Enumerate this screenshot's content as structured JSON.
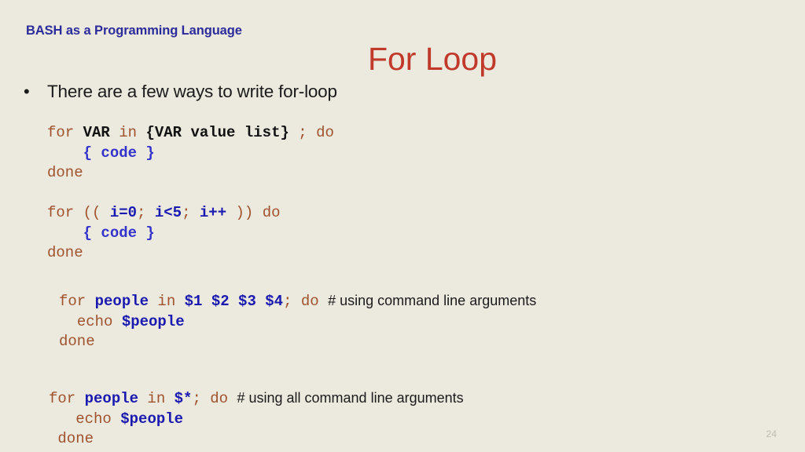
{
  "slide": {
    "kicker": "BASH as a Programming Language",
    "title": "For Loop",
    "bullet_marker": "•",
    "bullet_text": "There are a few ways to write for-loop",
    "page_number": "24",
    "colors": {
      "background": "#ECE9DE",
      "kicker": "#2B2B9B",
      "title": "#C0392B",
      "keyword": "#A0522D",
      "literal": "#111111",
      "code_placeholder": "#3333CC",
      "variable": "#1A1AB0",
      "comment": "#1b1b1b",
      "page_number": "#BDBBAF"
    }
  },
  "code_blocks": [
    {
      "id": "block-1",
      "lines": [
        {
          "indent": "",
          "tokens": [
            {
              "text": "for ",
              "kind": "keyword"
            },
            {
              "text": "VAR",
              "kind": "literal"
            },
            {
              "text": " in ",
              "kind": "keyword"
            },
            {
              "text": "{VAR value list}",
              "kind": "literal"
            },
            {
              "text": " ; ",
              "kind": "keyword"
            },
            {
              "text": "do",
              "kind": "keyword"
            }
          ]
        },
        {
          "indent": "    ",
          "tokens": [
            {
              "text": "{ code }",
              "kind": "code_placeholder"
            }
          ]
        },
        {
          "indent": "",
          "tokens": [
            {
              "text": "done",
              "kind": "keyword"
            }
          ]
        }
      ]
    },
    {
      "id": "block-2",
      "lines": [
        {
          "indent": "",
          "tokens": [
            {
              "text": "for ",
              "kind": "keyword"
            },
            {
              "text": "(( ",
              "kind": "punctuation"
            },
            {
              "text": "i=0",
              "kind": "expression"
            },
            {
              "text": "; ",
              "kind": "punctuation"
            },
            {
              "text": "i<5",
              "kind": "expression"
            },
            {
              "text": "; ",
              "kind": "punctuation"
            },
            {
              "text": "i++",
              "kind": "expression"
            },
            {
              "text": " )) ",
              "kind": "punctuation"
            },
            {
              "text": "do",
              "kind": "keyword"
            }
          ]
        },
        {
          "indent": "    ",
          "tokens": [
            {
              "text": "{ code }",
              "kind": "code_placeholder"
            }
          ]
        },
        {
          "indent": "",
          "tokens": [
            {
              "text": "done",
              "kind": "keyword"
            }
          ]
        }
      ]
    },
    {
      "id": "block-3",
      "lines": [
        {
          "indent": "",
          "tokens": [
            {
              "text": "for ",
              "kind": "keyword"
            },
            {
              "text": "people",
              "kind": "variable"
            },
            {
              "text": " in ",
              "kind": "keyword"
            },
            {
              "text": "$1 $2 $3 $4",
              "kind": "variable"
            },
            {
              "text": "; ",
              "kind": "keyword"
            },
            {
              "text": "do ",
              "kind": "keyword"
            },
            {
              "text": "# using command line arguments",
              "kind": "comment"
            }
          ]
        },
        {
          "indent": "  ",
          "tokens": [
            {
              "text": "echo ",
              "kind": "keyword"
            },
            {
              "text": "$people",
              "kind": "variable"
            }
          ]
        },
        {
          "indent": "",
          "tokens": [
            {
              "text": "done",
              "kind": "keyword"
            }
          ]
        }
      ]
    },
    {
      "id": "block-4",
      "lines": [
        {
          "indent": "",
          "tokens": [
            {
              "text": "for ",
              "kind": "keyword"
            },
            {
              "text": "people",
              "kind": "variable"
            },
            {
              "text": " in ",
              "kind": "keyword"
            },
            {
              "text": "$*",
              "kind": "variable"
            },
            {
              "text": "; ",
              "kind": "keyword"
            },
            {
              "text": "do ",
              "kind": "keyword"
            },
            {
              "text": "# using all command line arguments",
              "kind": "comment"
            }
          ]
        },
        {
          "indent": "   ",
          "tokens": [
            {
              "text": "echo ",
              "kind": "keyword"
            },
            {
              "text": "$people",
              "kind": "variable"
            }
          ]
        },
        {
          "indent": " ",
          "tokens": [
            {
              "text": "done",
              "kind": "keyword"
            }
          ]
        }
      ]
    }
  ]
}
